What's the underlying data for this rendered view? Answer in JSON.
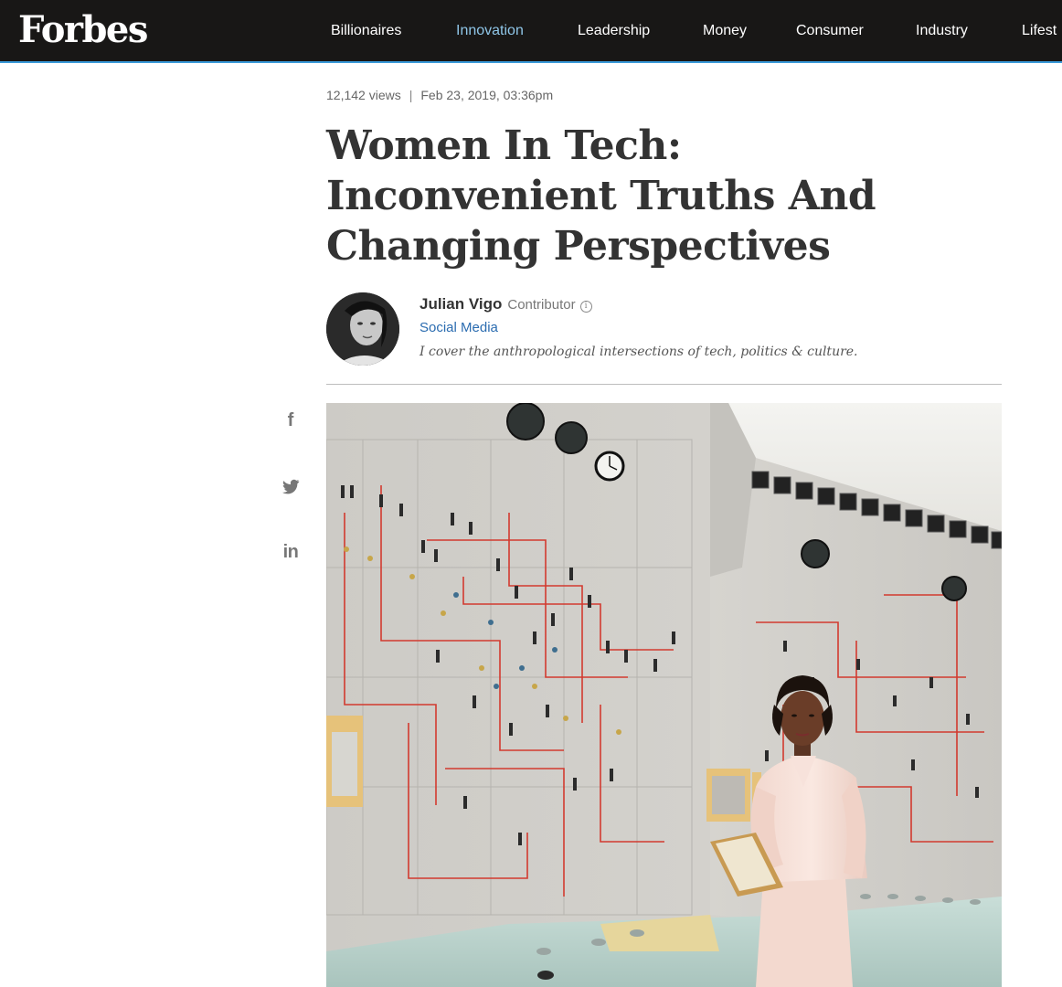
{
  "header": {
    "logo": "Forbes",
    "nav": [
      {
        "label": "Billionaires",
        "active": false
      },
      {
        "label": "Innovation",
        "active": true
      },
      {
        "label": "Leadership",
        "active": false
      },
      {
        "label": "Money",
        "active": false
      },
      {
        "label": "Consumer",
        "active": false
      },
      {
        "label": "Industry",
        "active": false
      },
      {
        "label": "Lifest",
        "active": false
      }
    ]
  },
  "article": {
    "views": "12,142 views",
    "separator": "|",
    "date": "Feb 23, 2019, 03:36pm",
    "headline": "Women In Tech: Inconvenient Truths And Changing Perspectives",
    "author": {
      "name": "Julian Vigo",
      "role": "Contributor",
      "info_icon": "i",
      "section": "Social Media",
      "bio": "I cover the anthropological intersections of tech, politics & culture."
    }
  },
  "share": {
    "facebook_icon": "f",
    "twitter_icon": "twitter-bird",
    "linkedin_icon": "in"
  },
  "colors": {
    "nav_bg": "#181716",
    "nav_accent": "#3a9ad9",
    "active_nav": "#8fc6e8",
    "link": "#2b6cb0"
  }
}
